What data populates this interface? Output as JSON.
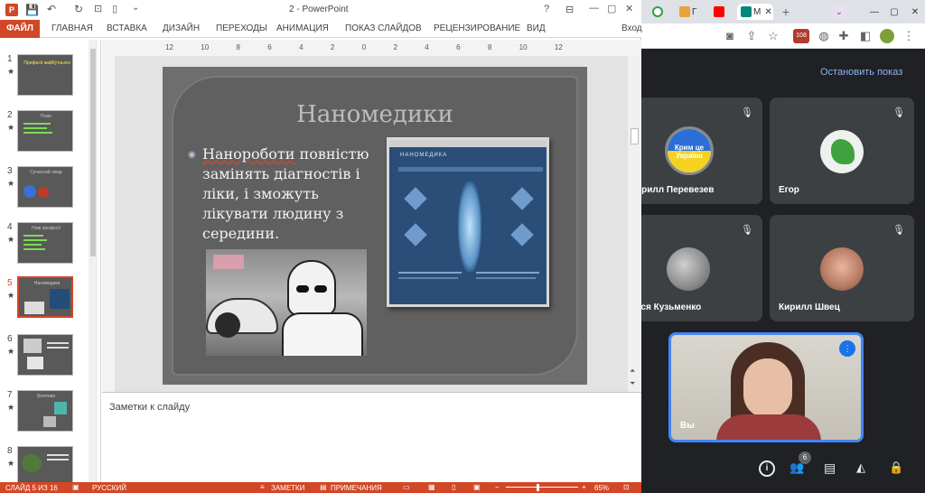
{
  "ppt": {
    "window_title": "2 - PowerPoint",
    "help": "?",
    "ribbon_tabs": [
      "ФАЙЛ",
      "ГЛАВНАЯ",
      "ВСТАВКА",
      "ДИЗАЙН",
      "ПЕРЕХОДЫ",
      "АНИМАЦИЯ",
      "ПОКАЗ СЛАЙДОВ",
      "РЕЦЕНЗИРОВАНИЕ",
      "ВИД"
    ],
    "signin": "Вход",
    "ruler_labels": [
      "12",
      "10",
      "8",
      "6",
      "4",
      "2",
      "0",
      "2",
      "4",
      "6",
      "8",
      "10",
      "12"
    ],
    "thumbnails": [
      {
        "num": "1",
        "star": "★",
        "text": "Професії майбутнього"
      },
      {
        "num": "2",
        "star": "★",
        "text": "План"
      },
      {
        "num": "3",
        "star": "★",
        "text": "Сучасний лікар"
      },
      {
        "num": "4",
        "star": "★",
        "text": "Нові професії"
      },
      {
        "num": "5",
        "star": "★",
        "text": "Наномедики"
      },
      {
        "num": "6",
        "star": "★",
        "text": ""
      },
      {
        "num": "7",
        "star": "★",
        "text": "Біоетики"
      },
      {
        "num": "8",
        "star": "★",
        "text": ""
      }
    ],
    "slide": {
      "title": "Наномедики",
      "bullet_word": "Нанороботи",
      "bullet_rest": " повністю замінять діагностів і ліки, і зможуть лікувати людину з середини.",
      "website_logo": "НАНОМЕДИКА"
    },
    "notes_placeholder": "Заметки к слайду",
    "status": {
      "slide_info": "СЛАЙД 5 ИЗ 16",
      "language": "РУССКИЙ",
      "notes": "ЗАМЕТКИ",
      "comments": "ПРИМЕЧАНИЯ",
      "zoom": "65%"
    }
  },
  "browser": {
    "tab_label": "М",
    "tab_label_2": "Г",
    "badge": "108"
  },
  "meet": {
    "stop_presenting": "Остановить показ",
    "participants": [
      {
        "name": "ирилл Перевезев",
        "avatar_text": "Крим це Україна"
      },
      {
        "name": "Егор"
      },
      {
        "name": "еся Кузьменко"
      },
      {
        "name": "Кирилл Швец"
      }
    ],
    "self_name": "Вы",
    "participants_count": "6"
  },
  "colors": {
    "ppt_accent": "#d24726",
    "meet_bg": "#202124",
    "tile_bg": "#3c4043",
    "meet_link": "#8ab4f8",
    "self_border": "#4285f4"
  }
}
